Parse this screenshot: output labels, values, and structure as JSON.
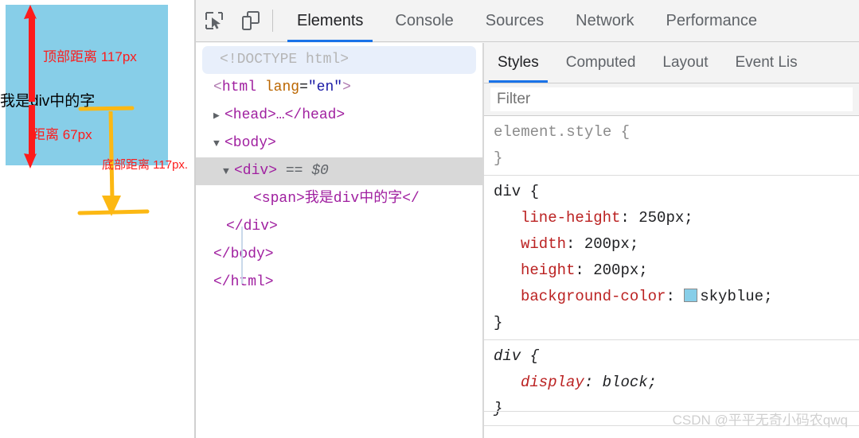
{
  "viewport": {
    "div_text": "我是div中的字",
    "box_color": "#87cee8",
    "annotations": {
      "top_label": "顶部距离 117px",
      "middle_label": "距离 67px",
      "bottom_label": "底部距离 117px.",
      "red_color": "#fd1b1b",
      "yellow_color": "#fcb813"
    }
  },
  "devtools": {
    "toolbar": {
      "inspect_icon": "inspect-element-icon",
      "device_icon": "device-toolbar-icon",
      "tabs": [
        {
          "label": "Elements",
          "active": true
        },
        {
          "label": "Console",
          "active": false
        },
        {
          "label": "Sources",
          "active": false
        },
        {
          "label": "Network",
          "active": false
        },
        {
          "label": "Performance",
          "active": false
        }
      ]
    },
    "dom_tree": {
      "doctype": "<!DOCTYPE html>",
      "html_open_lt": "<",
      "html_tag": "html",
      "html_attr_name": "lang",
      "html_attr_eq": "=",
      "html_attr_value": "\"en\"",
      "html_open_gt": ">",
      "head_collapsed": "<head>…</head>",
      "body_open": "<body>",
      "div_open": "<div>",
      "div_marker": "== $0",
      "span_line": "<span>我是div中的字</",
      "div_close": "</div>",
      "body_close": "</body>",
      "html_close": "</html>",
      "expand_triangle_collapsed": "▶",
      "expand_triangle_expanded": "▼"
    },
    "styles": {
      "tabs": [
        {
          "label": "Styles",
          "active": true
        },
        {
          "label": "Computed",
          "active": false
        },
        {
          "label": "Layout",
          "active": false
        },
        {
          "label": "Event Lis",
          "active": false
        }
      ],
      "filter_placeholder": "Filter",
      "filter_value": "",
      "rules": [
        {
          "selector": "element.style",
          "origin": "inline",
          "declarations": []
        },
        {
          "selector": "div",
          "origin": "author",
          "declarations": [
            {
              "property": "line-height",
              "value": "250px"
            },
            {
              "property": "width",
              "value": "200px"
            },
            {
              "property": "height",
              "value": "200px"
            },
            {
              "property": "background-color",
              "value": "skyblue",
              "swatch": "#87cee8"
            }
          ]
        },
        {
          "selector": "div",
          "origin": "user-agent",
          "declarations": [
            {
              "property": "display",
              "value": "block"
            }
          ]
        }
      ],
      "open_brace": "{",
      "close_brace": "}",
      "colon": ":",
      "semicolon": ";"
    },
    "watermark": "CSDN @平平无奇小码农qwq"
  }
}
